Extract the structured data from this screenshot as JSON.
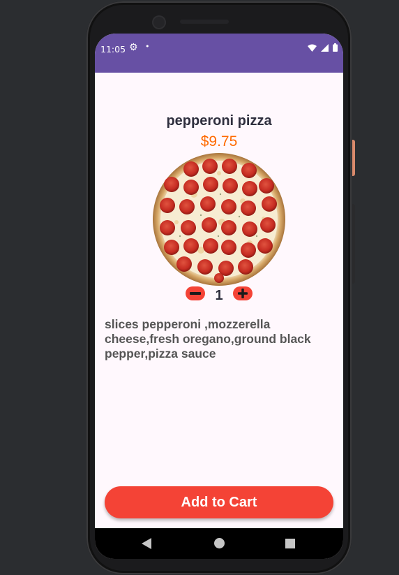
{
  "status_bar": {
    "time": "11:05",
    "background": "#6750a4"
  },
  "product": {
    "name": "pepperoni pizza",
    "price": "$9.75",
    "quantity": "1",
    "description": "slices pepperoni ,mozzerella cheese,fresh oregano,ground black pepper,pizza sauce"
  },
  "actions": {
    "add_to_cart": "Add to Cart"
  },
  "icons": {
    "settings": "gear-icon",
    "notification": "dot-icon",
    "wifi": "wifi-icon",
    "signal": "signal-icon",
    "battery": "battery-icon",
    "decrease": "minus-icon",
    "increase": "plus-icon",
    "back": "back-triangle-icon",
    "home": "home-circle-icon",
    "recents": "recents-square-icon"
  },
  "colors": {
    "accent": "#f44336",
    "price": "#ff6a00",
    "title": "#2f2f3e",
    "screen_bg": "#fff8fd"
  }
}
